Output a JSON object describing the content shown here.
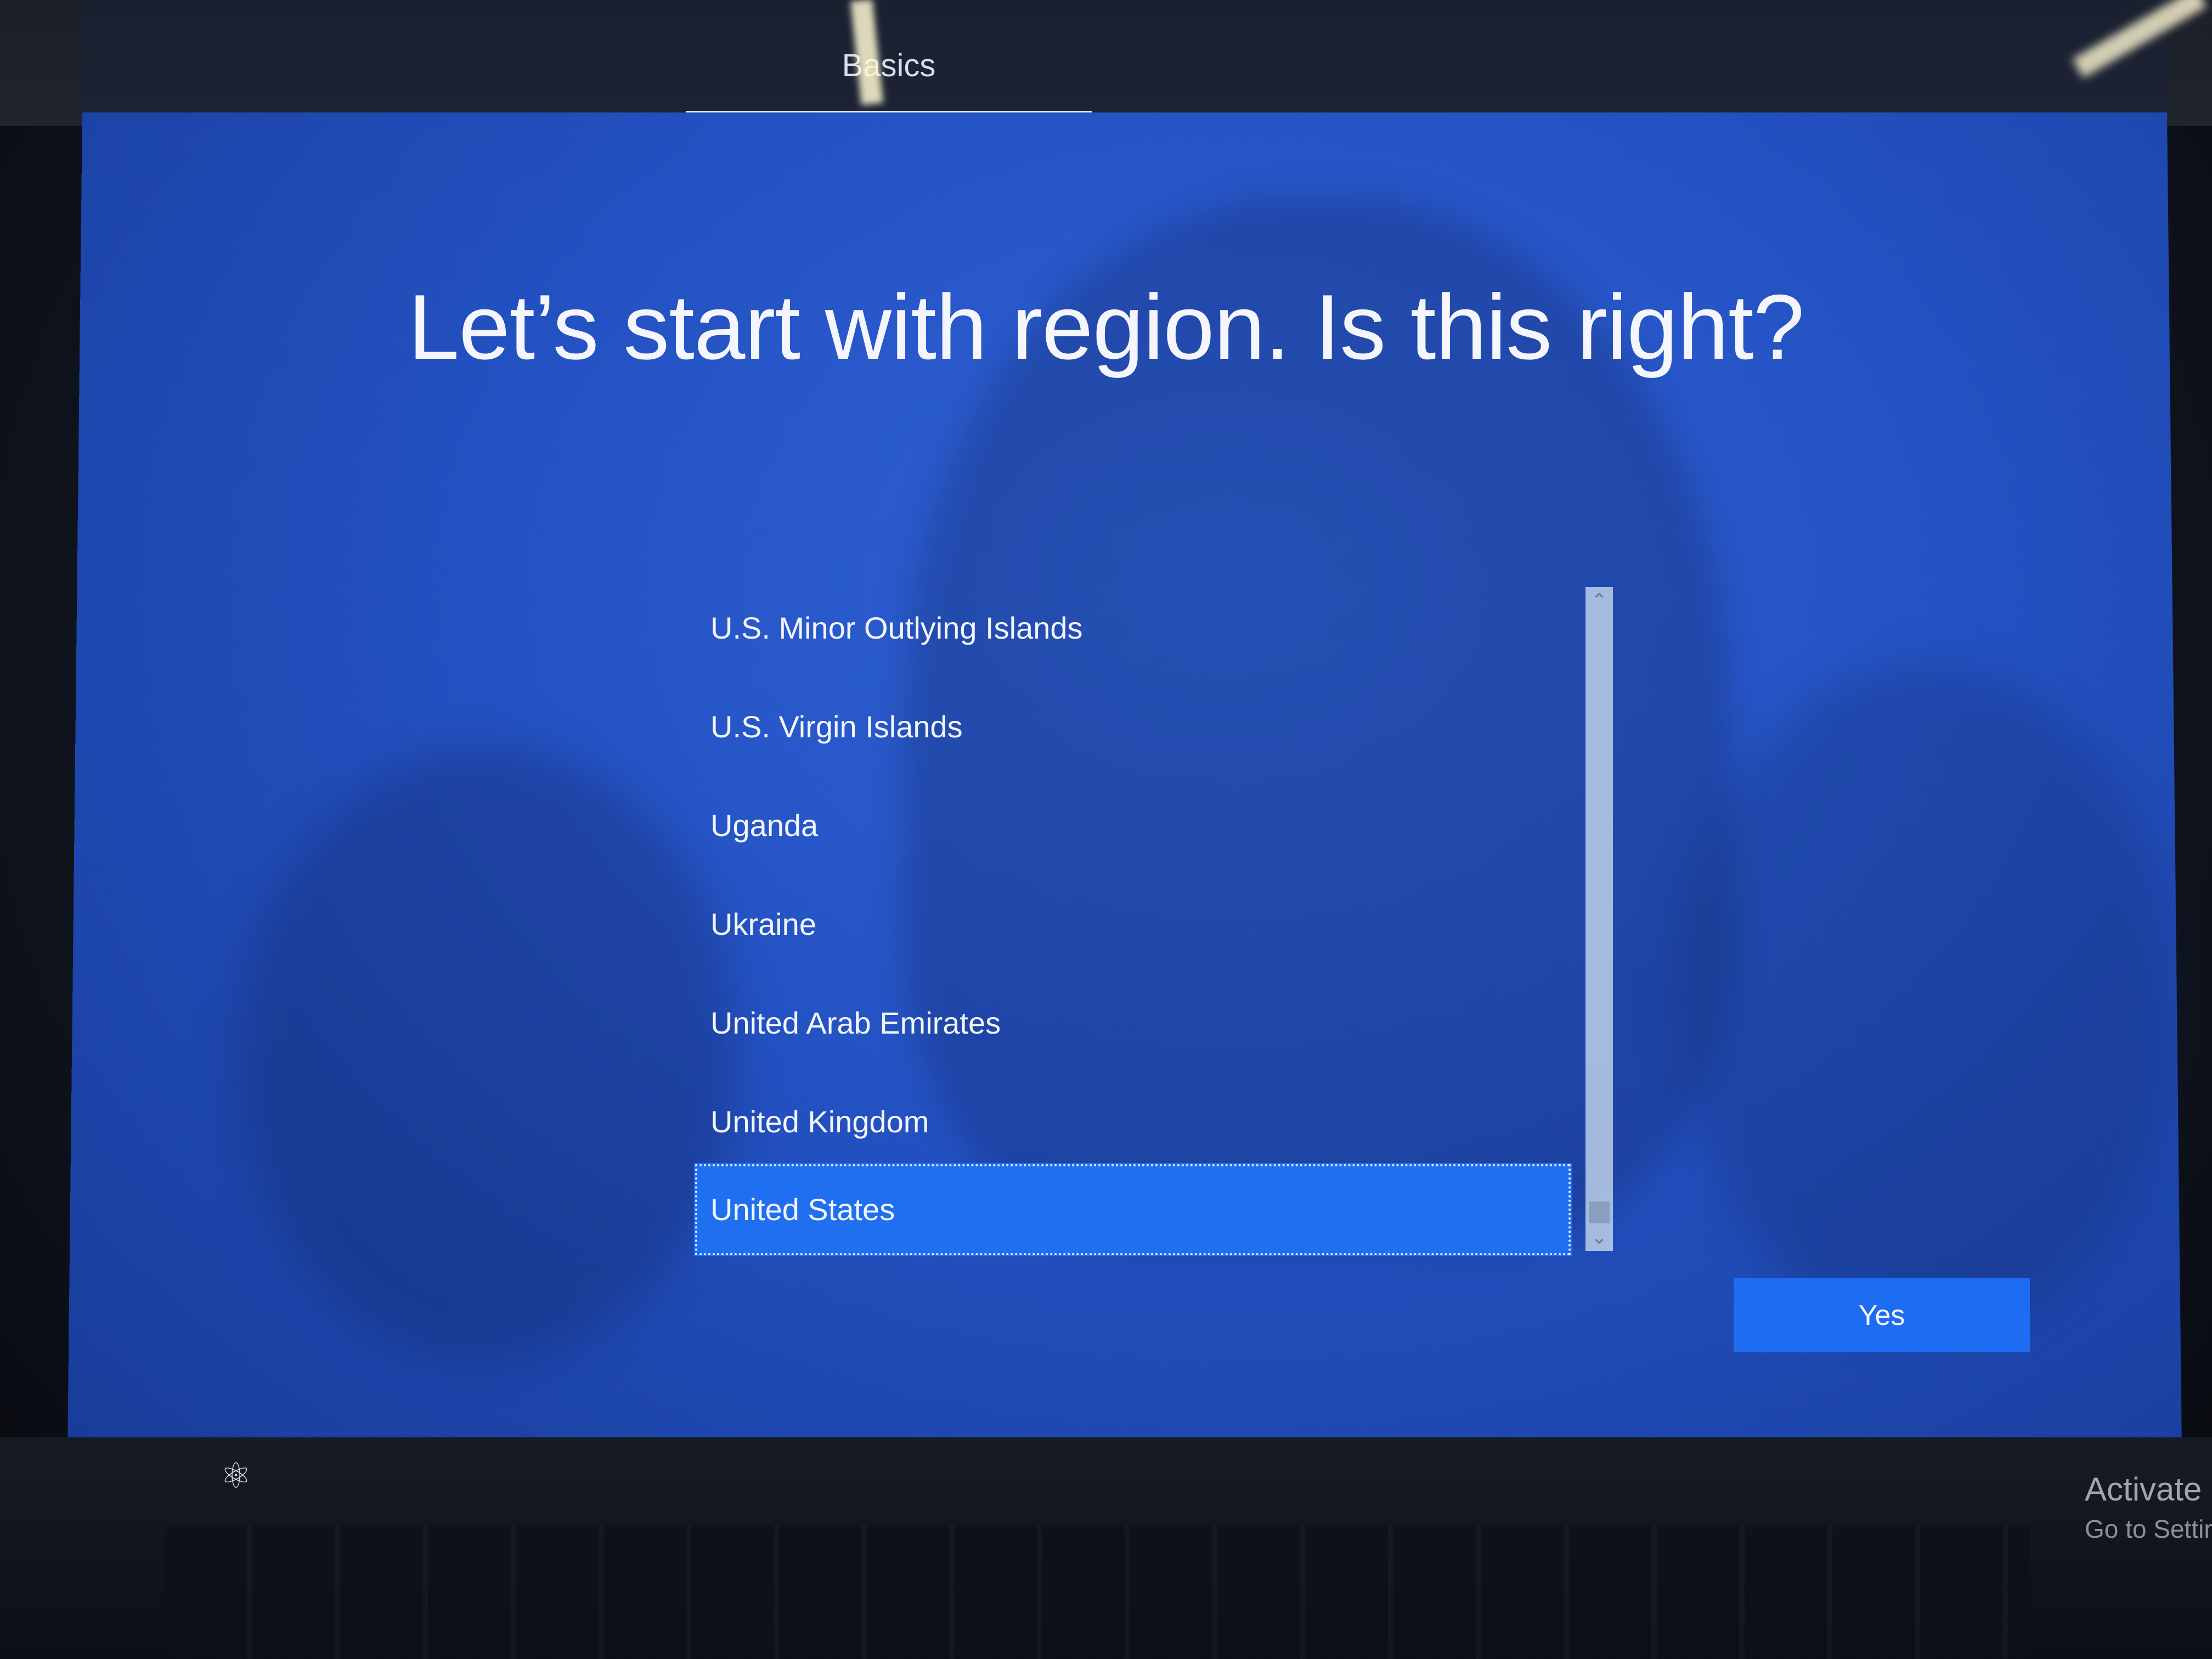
{
  "header": {
    "tab_label": "Basics"
  },
  "main": {
    "title": "Let’s start with region. Is this right?",
    "regions": [
      "U.S. Minor Outlying Islands",
      "U.S. Virgin Islands",
      "Uganda",
      "Ukraine",
      "United Arab Emirates",
      "United Kingdom",
      "United States"
    ],
    "selected_region": "United States",
    "confirm_label": "Yes"
  },
  "footer": {
    "accessibility_icon": "accessibility-icon",
    "watermark_line1": "Activate",
    "watermark_line2": "Go to Settir"
  },
  "colors": {
    "screen_background": "#2452c3",
    "accent": "#1d6cf2"
  }
}
